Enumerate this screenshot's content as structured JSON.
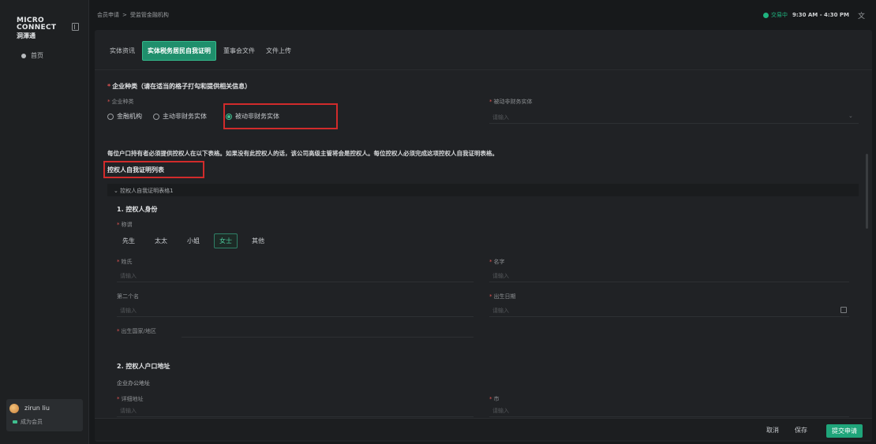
{
  "sidebar": {
    "logo_line1": "MICRO",
    "logo_line2": "CONNECT",
    "logo_line3": "洞澤通",
    "home": "首页",
    "user_name": "zirun liu",
    "member_label": "成为会员"
  },
  "topbar": {
    "breadcrumb_1": "会员申请",
    "breadcrumb_sep": ">",
    "breadcrumb_2": "受监管金融机构",
    "status_label": "交易中",
    "trading_hours": "9:30 AM - 4:30 PM",
    "lang_icon": "文"
  },
  "tabs": [
    {
      "label": "实体资讯"
    },
    {
      "label": "实体税务居民自我证明",
      "active": true
    },
    {
      "label": "董事会文件"
    },
    {
      "label": "文件上传"
    }
  ],
  "entity": {
    "section_title": "企业种类（请在适当的格子打勾和提供相关信息）",
    "type_label": "企业种类",
    "options": [
      "金融机构",
      "主动非财务实体",
      "被动非财务实体"
    ],
    "selected_option": "被动非财务实体",
    "passive_label": "被动非财务实体",
    "passive_placeholder": "请输入"
  },
  "notice": "每位户口持有者必须提供控权人在以下表格。如果没有此控权人的话，该公司高级主管将会是控权人。每位控权人必须完成这项控权人自我证明表格。",
  "controller_list_title": "控权人自我证明列表",
  "accordion_label": "控权人自我证明表格1",
  "identity": {
    "title": "1. 控权人身份",
    "salutation_label": "称谓",
    "salutations": [
      "先生",
      "太太",
      "小姐",
      "女士",
      "其他"
    ],
    "selected": "女士",
    "surname_label": "姓氏",
    "given_name_label": "名字",
    "middle_name_label": "第二个名",
    "dob_label": "出生日期",
    "birth_country_label": "出生国家/地区",
    "placeholder": "请输入"
  },
  "address": {
    "title": "2. 控权人户口地址",
    "office_label": "企业办公地址",
    "detail_label": "详细地址",
    "city_label": "市",
    "placeholder": "请输入"
  },
  "footer": {
    "cancel": "取消",
    "save": "保存",
    "submit": "提交申请"
  },
  "colors": {
    "accent": "#1f8f6c",
    "highlight_box": "#d12b2b",
    "status_green": "#1fb37f"
  }
}
